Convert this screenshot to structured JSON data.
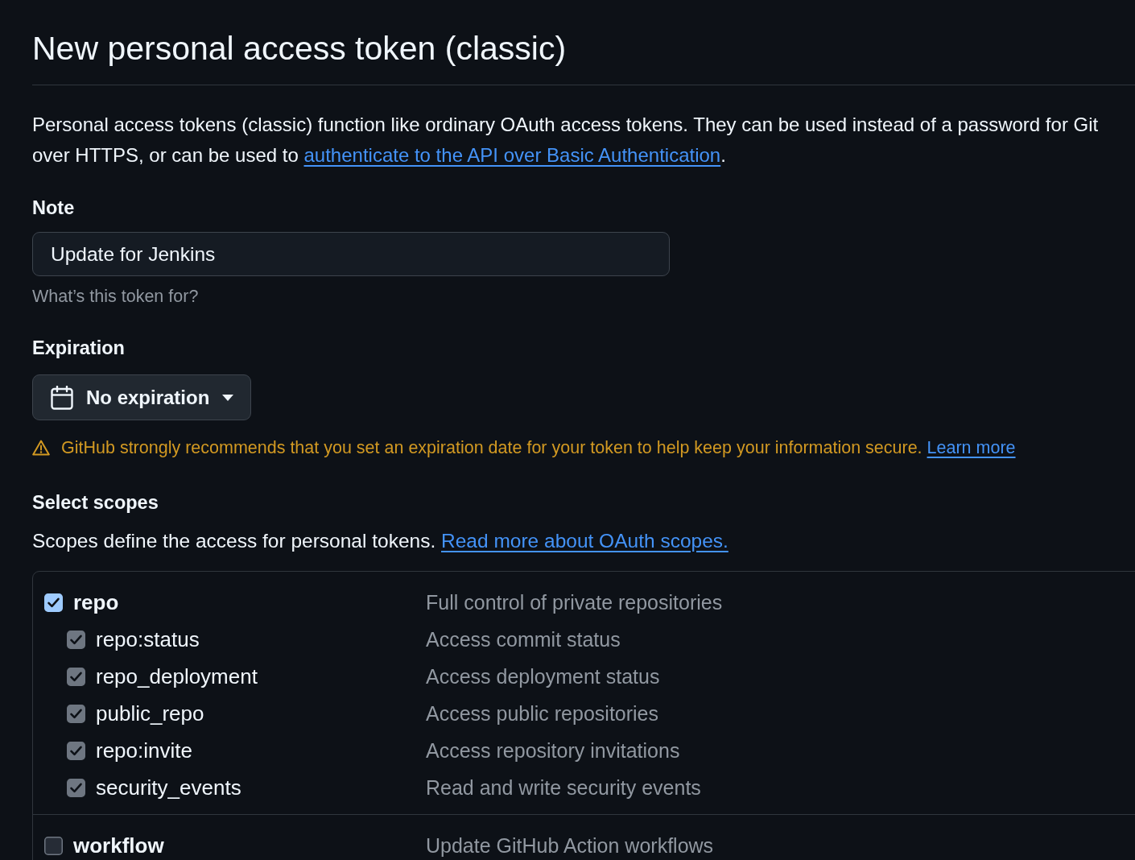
{
  "page": {
    "title": "New personal access token (classic)"
  },
  "intro": {
    "text": "Personal access tokens (classic) function like ordinary OAuth access tokens. They can be used instead of a password for Git over HTTPS, or can be used to ",
    "link": "authenticate to the API over Basic Authentication",
    "after": "."
  },
  "note": {
    "label": "Note",
    "value": "Update for Jenkins",
    "hint": "What’s this token for?"
  },
  "expiration": {
    "label": "Expiration",
    "value": "No expiration",
    "warning": {
      "text": "GitHub strongly recommends that you set an expiration date for your token to help keep your information secure.",
      "link": "Learn more"
    }
  },
  "scopes": {
    "title": "Select scopes",
    "description": "Scopes define the access for personal tokens.",
    "link": "Read more about OAuth scopes.",
    "groups": [
      {
        "name": "repo",
        "description": "Full control of private repositories",
        "checked": true,
        "children": [
          {
            "name": "repo:status",
            "description": "Access commit status",
            "checked": true,
            "disabled": true
          },
          {
            "name": "repo_deployment",
            "description": "Access deployment status",
            "checked": true,
            "disabled": true
          },
          {
            "name": "public_repo",
            "description": "Access public repositories",
            "checked": true,
            "disabled": true
          },
          {
            "name": "repo:invite",
            "description": "Access repository invitations",
            "checked": true,
            "disabled": true
          },
          {
            "name": "security_events",
            "description": "Read and write security events",
            "checked": true,
            "disabled": true
          }
        ]
      },
      {
        "name": "workflow",
        "description": "Update GitHub Action workflows",
        "checked": false
      }
    ]
  }
}
